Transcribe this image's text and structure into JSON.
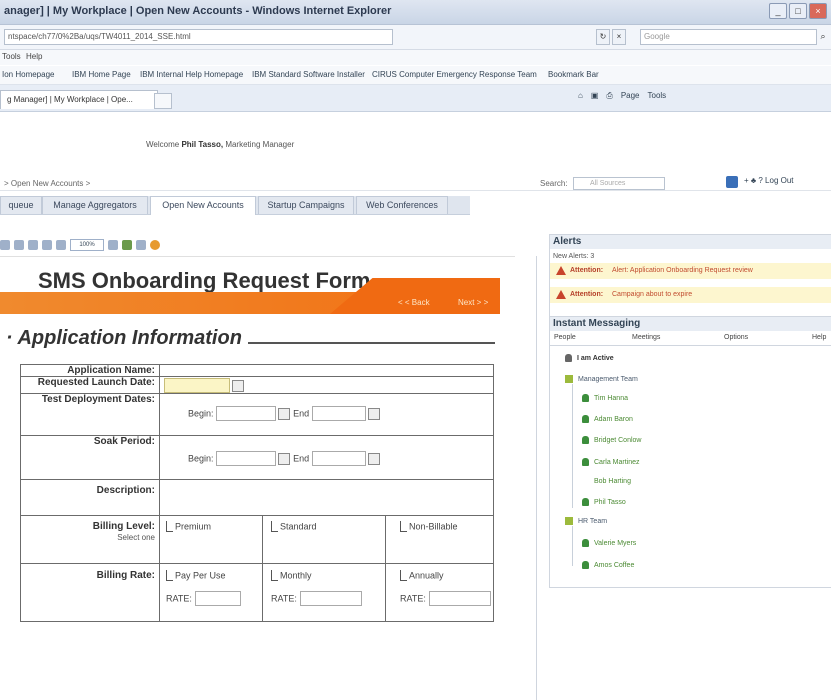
{
  "window": {
    "title": "anager] | My Workplace | Open New Accounts - Windows Internet Explorer",
    "address": "ntspace/ch77/0%2Ba/uqs/TW4011_2014_SSE.html",
    "search_placeholder": "Google"
  },
  "menubar": [
    "Tools",
    "Help"
  ],
  "favorites": [
    "Ion Homepage",
    "IBM Home Page",
    "IBM Internal Help Homepage",
    "IBM Standard Software Installer",
    "CIRUS Computer Emergency Response Team",
    "Bookmark Bar"
  ],
  "browser_tab": "g Manager] | My Workplace | Ope...",
  "command_bar": [
    "Page",
    "Tools"
  ],
  "portal": {
    "welcome_prefix": "Welcome",
    "welcome_name": "Phil Tasso,",
    "welcome_role": "Marketing Manager",
    "breadcrumb": "> Open New Accounts >",
    "search_label": "Search:",
    "search_placeholder": "All Sources",
    "right_links": "+ ♣ ? Log Out",
    "tabs": [
      "queue",
      "Manage Aggregators",
      "Open New Accounts",
      "Startup Campaigns",
      "Web Conferences"
    ]
  },
  "toolbar": {
    "zoom": "100%"
  },
  "form": {
    "title": "SMS Onboarding Request Form",
    "nav_back": "< < Back",
    "nav_next": "Next > >",
    "section": "Application Information",
    "rows": {
      "app_name": "Application Name:",
      "launch": "Requested Launch Date:",
      "test_dates": "Test Deployment Dates:",
      "soak": "Soak Period:",
      "description": "Description:",
      "billing_level": "Billing Level:",
      "billing_level_sub": "Select one",
      "billing_rate": "Billing Rate:"
    },
    "begin_label": "Begin:",
    "end_label": "End",
    "billing_levels": [
      "Premium",
      "Standard",
      "Non-Billable"
    ],
    "billing_rates": [
      "Pay Per Use",
      "Monthly",
      "Annually"
    ],
    "rate_label": "RATE:"
  },
  "alerts": {
    "header": "Alerts",
    "count": "New Alerts: 3",
    "items": [
      {
        "label": "Attention:",
        "text": "Alert: Application Onboarding Request review"
      },
      {
        "label": "Attention:",
        "text": "Campaign about to expire"
      }
    ]
  },
  "im": {
    "header": "Instant Messaging",
    "tabs": [
      "People",
      "Meetings",
      "Options",
      "Help"
    ],
    "status": "I am Active",
    "groups": [
      {
        "name": "Management Team",
        "members": [
          "Tim Hanna",
          "Adam Baron",
          "Bridget Conlow",
          "Carla Martinez",
          "Bob Harting",
          "Phil Tasso"
        ]
      },
      {
        "name": "HR Team",
        "members": [
          "Valerie Myers",
          "Amos Coffee"
        ]
      }
    ]
  }
}
